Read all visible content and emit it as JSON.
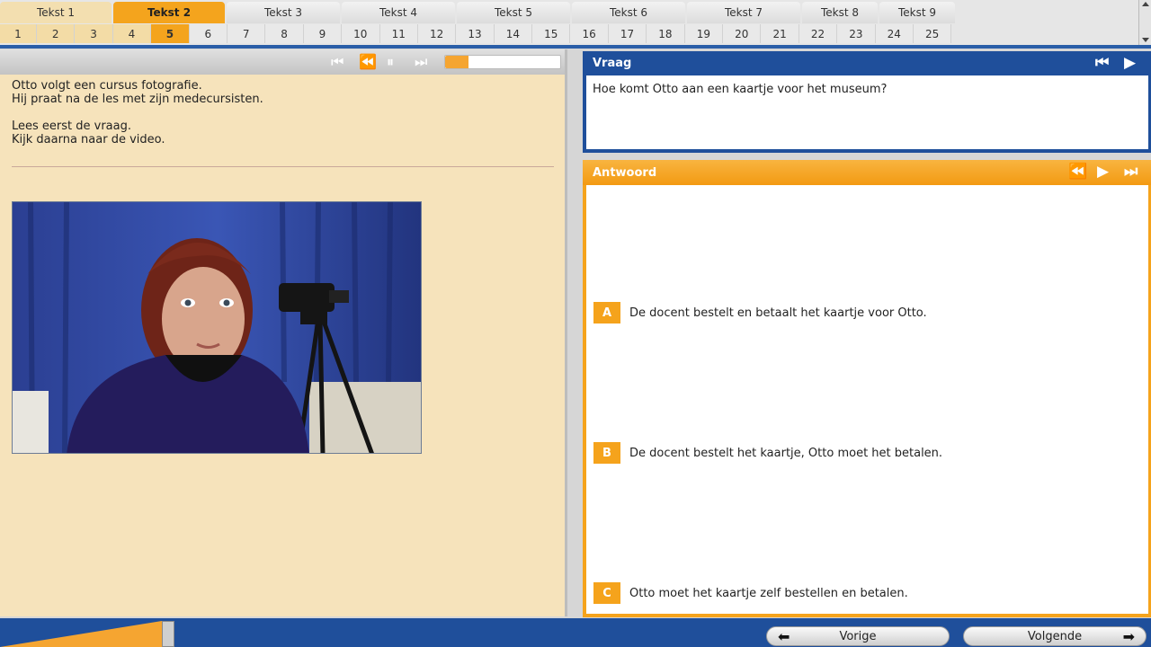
{
  "tabs": [
    {
      "label": "Tekst 1",
      "state": "done"
    },
    {
      "label": "Tekst 2",
      "state": "active"
    },
    {
      "label": "Tekst 3",
      "state": ""
    },
    {
      "label": "Tekst 4",
      "state": ""
    },
    {
      "label": "Tekst 5",
      "state": ""
    },
    {
      "label": "Tekst 6",
      "state": ""
    },
    {
      "label": "Tekst 7",
      "state": ""
    },
    {
      "label": "Tekst 8",
      "state": ""
    },
    {
      "label": "Tekst 9",
      "state": ""
    }
  ],
  "questions": [
    "1",
    "2",
    "3",
    "4",
    "5",
    "6",
    "7",
    "8",
    "9",
    "10",
    "11",
    "12",
    "13",
    "14",
    "15",
    "16",
    "17",
    "18",
    "19",
    "20",
    "21",
    "22",
    "23",
    "24",
    "25"
  ],
  "current_question": "5",
  "intro": {
    "text": "Otto volgt een cursus fotografie.\nHij praat na de les met zijn medecursisten.\n\nLees eerst de vraag.\nKijk daarna naar de video."
  },
  "video_progress": 0.2,
  "vraag": {
    "title": "Vraag",
    "text": "Hoe komt Otto aan een kaartje voor het museum?"
  },
  "antwoord": {
    "title": "Antwoord",
    "options": [
      {
        "letter": "A",
        "text": "De docent bestelt en betaalt het kaartje voor Otto."
      },
      {
        "letter": "B",
        "text": "De docent bestelt het kaartje, Otto moet het betalen."
      },
      {
        "letter": "C",
        "text": "Otto moet het kaartje zelf bestellen en betalen."
      }
    ]
  },
  "footer": {
    "prev_label": "Vorige",
    "next_label": "Volgende"
  },
  "colors": {
    "accent": "#f5a31c",
    "blue": "#1f4f9b",
    "panel": "#f6e3bb"
  }
}
